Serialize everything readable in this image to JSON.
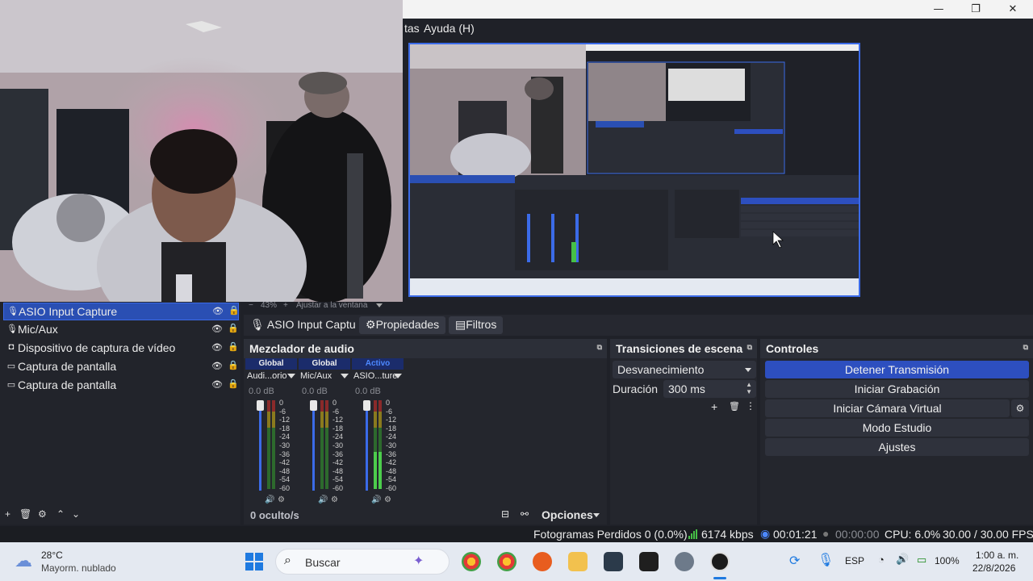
{
  "titlebar": {
    "minimize": "—",
    "maximize": "❐",
    "close": "✕"
  },
  "menubar": {
    "item_partial": "tas",
    "help": "Ayuda (H)"
  },
  "zoombar": {
    "minus": "−",
    "zoom": "43%",
    "plus": "+",
    "fit": "Ajustar a la ventana"
  },
  "sources": {
    "items": [
      {
        "icon": "mic-icon",
        "glyph": "🎙",
        "label": "ASIO Input Capture",
        "selected": true
      },
      {
        "icon": "mic-icon",
        "glyph": "🎙",
        "label": "Mic/Aux",
        "selected": false
      },
      {
        "icon": "camera-icon",
        "glyph": "◘",
        "label": "Dispositivo de captura de vídeo",
        "selected": false
      },
      {
        "icon": "monitor-icon",
        "glyph": "▭",
        "label": "Captura de pantalla",
        "selected": false
      },
      {
        "icon": "monitor-icon",
        "glyph": "▭",
        "label": "Captura de pantalla",
        "selected": false
      }
    ],
    "tools": {
      "add": "+",
      "remove": "🗑",
      "settings": "⚙",
      "up": "⌃",
      "down": "⌄"
    }
  },
  "propbar": {
    "source": "ASIO Input Captu",
    "properties": "Propiedades",
    "filters": "Filtros"
  },
  "mixer": {
    "title": "Mezclador de audio",
    "channels": [
      {
        "header": "Global",
        "name": "Audi...orio",
        "db": "0.0 dB",
        "level": 0.0,
        "active": false
      },
      {
        "header": "Global",
        "name": "Mic/Aux",
        "db": "0.0 dB",
        "level": 0.0,
        "active": false
      },
      {
        "header": "Activo",
        "name": "ASIO...ture",
        "db": "0.0 dB",
        "level": 0.42,
        "active": true
      }
    ],
    "scale": [
      "0",
      "-6",
      "-12",
      "-18",
      "-24",
      "-30",
      "-36",
      "-42",
      "-48",
      "-54",
      "-60"
    ],
    "hidden": "0 oculto/s",
    "options": "Opciones"
  },
  "transitions": {
    "title": "Transiciones de escena",
    "selected": "Desvanecimiento",
    "duration_label": "Duración",
    "duration_value": "300 ms"
  },
  "controls": {
    "title": "Controles",
    "stop_stream": "Detener Transmisión",
    "start_record": "Iniciar Grabación",
    "virtual_cam": "Iniciar Cámara Virtual",
    "studio_mode": "Modo Estudio",
    "settings": "Ajustes"
  },
  "status": {
    "dropped": "Fotogramas Perdidos 0 (0.0%)",
    "bitrate": "6174 kbps",
    "stream_time": "00:01:21",
    "rec_time": "00:00:00",
    "cpu": "CPU: 6.0%",
    "fps": "30.00 / 30.00 FPS"
  },
  "taskbar": {
    "temp": "28°C",
    "weather": "Mayorm. nublado",
    "search": "Buscar",
    "lang": "ESP",
    "battery": "100%",
    "time": "1:00 a. m.",
    "date": "22/8/2026"
  },
  "colors": {
    "accent": "#3b6be8",
    "panel": "#24262d",
    "taskbar": "#e4e9f1"
  }
}
